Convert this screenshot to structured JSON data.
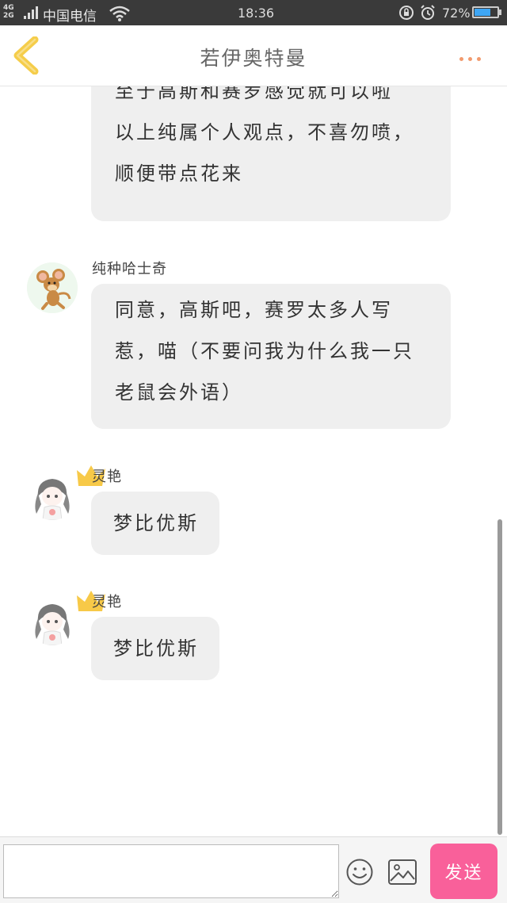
{
  "status_bar": {
    "network": "4G 2G",
    "carrier": "中国电信",
    "time": "18:36",
    "battery": "72%",
    "battery_level": 0.72
  },
  "header": {
    "title": "若伊奥特曼"
  },
  "messages": [
    {
      "lines": [
        "至于高斯和赛罗感觉就可以啦",
        "以上纯属个人观点，不喜勿喷，",
        "顺便带点花来"
      ]
    },
    {
      "sender": "纯种哈士奇",
      "lines": [
        "同意，高斯吧，赛罗太多人写",
        "惹，喵（不要问我为什么我一只",
        "老鼠会外语）"
      ]
    },
    {
      "sender": "灵艳",
      "lines": [
        "梦比优斯"
      ]
    },
    {
      "sender": "灵艳",
      "lines": [
        "梦比优斯"
      ]
    }
  ],
  "input": {
    "value": "",
    "placeholder": ""
  },
  "send_label": "发送",
  "colors": {
    "accent": "#f9609a",
    "back_arrow": "#f5cd4a",
    "more_dots": "#f29a6e",
    "bubble": "#efefef"
  }
}
